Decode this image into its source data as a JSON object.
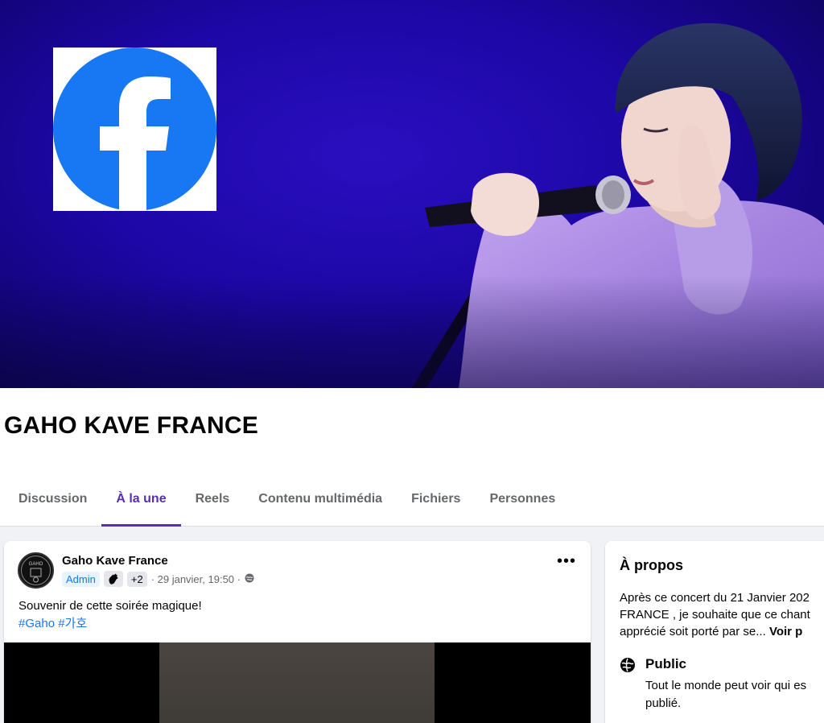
{
  "cover": {
    "logo_icon": "facebook-logo-icon",
    "image_description_icon": "singer-with-microphone-image",
    "background_color": "#1d07a6"
  },
  "group": {
    "title": "GAHO KAVE FRANCE"
  },
  "tabs": [
    {
      "label": "Discussion",
      "active": false
    },
    {
      "label": "À la une",
      "active": true
    },
    {
      "label": "Reels",
      "active": false
    },
    {
      "label": "Contenu multimédia",
      "active": false
    },
    {
      "label": "Fichiers",
      "active": false
    },
    {
      "label": "Personnes",
      "active": false
    }
  ],
  "post": {
    "author": "Gaho Kave France",
    "badge_admin": "Admin",
    "badge_icon": "waving-hand-icon",
    "badge_plus": "+2",
    "timestamp": "· 29 janvier, 19:50 ·",
    "privacy_icon": "globe-icon",
    "more_icon": "•••",
    "text": "Souvenir de cette soirée magique!",
    "hashtags": [
      "#Gaho",
      "#가호"
    ]
  },
  "about": {
    "title": "À propos",
    "description_lines": [
      "Après ce concert du 21 Janvier 202",
      "FRANCE , je souhaite que ce chant",
      "apprécié soit porté par se..."
    ],
    "voir_plus": "Voir p",
    "privacy_title": "Public",
    "privacy_desc_lines": [
      "Tout le monde peut voir qui es",
      "publié."
    ]
  },
  "colors": {
    "accent": "#5a2eb2",
    "link": "#1877f2",
    "facebook_blue": "#1877f2"
  }
}
